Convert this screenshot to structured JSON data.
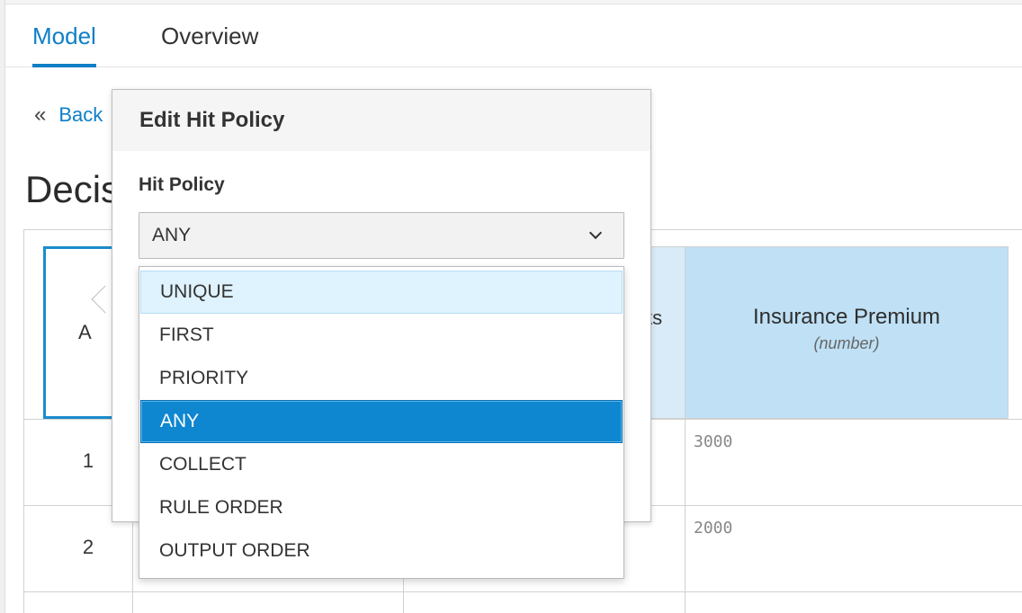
{
  "tabs": [
    {
      "label": "Model",
      "active": true
    },
    {
      "label": "Overview",
      "active": false
    }
  ],
  "back_link": {
    "icon": "double-chevron-left-icon",
    "label": "Back"
  },
  "page_title": "Decis",
  "table": {
    "hit_policy_cell": "A",
    "header_partial": "ts",
    "output_column": {
      "title": "Insurance Premium",
      "type": "(number)"
    },
    "rows": [
      {
        "num": "1",
        "value": "3000"
      },
      {
        "num": "2",
        "value": "2000"
      }
    ]
  },
  "popover": {
    "title": "Edit Hit Policy",
    "field_label": "Hit Policy",
    "selected_value": "ANY",
    "options": [
      "UNIQUE",
      "FIRST",
      "PRIORITY",
      "ANY",
      "COLLECT",
      "RULE ORDER",
      "OUTPUT ORDER"
    ],
    "hovered_option": "UNIQUE"
  },
  "colors": {
    "accent": "#0e7fc7",
    "selected_option": "#0e86d0",
    "header_bg": "#bfe0f5"
  }
}
